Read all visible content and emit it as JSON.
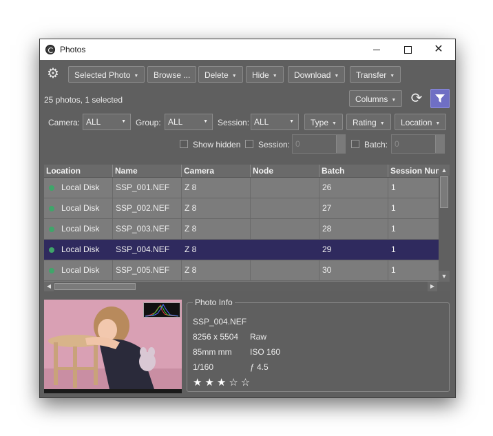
{
  "window": {
    "title": "Photos"
  },
  "toolbar": {
    "buttons": [
      {
        "label": "Selected Photo"
      },
      {
        "label": "Browse ..."
      },
      {
        "label": "Delete"
      },
      {
        "label": "Hide"
      },
      {
        "label": "Download"
      },
      {
        "label": "Transfer"
      }
    ],
    "status": "25 photos, 1 selected",
    "columns_label": "Columns"
  },
  "filters": {
    "camera_label": "Camera:",
    "camera_value": "ALL",
    "group_label": "Group:",
    "group_value": "ALL",
    "session_label": "Session:",
    "session_value": "ALL",
    "type_label": "Type",
    "rating_label": "Rating",
    "location_label": "Location",
    "show_hidden_label": "Show hidden",
    "session_spin_label": "Session:",
    "session_spin_value": "0",
    "batch_label": "Batch:",
    "batch_value": "0"
  },
  "table": {
    "columns": [
      "Location",
      "Name",
      "Camera",
      "Node",
      "Batch",
      "Session Num"
    ],
    "rows": [
      {
        "location": "Local Disk",
        "name": "SSP_001.NEF",
        "camera": "Z 8",
        "node": "",
        "batch": "26",
        "session": "1"
      },
      {
        "location": "Local Disk",
        "name": "SSP_002.NEF",
        "camera": "Z 8",
        "node": "",
        "batch": "27",
        "session": "1"
      },
      {
        "location": "Local Disk",
        "name": "SSP_003.NEF",
        "camera": "Z 8",
        "node": "",
        "batch": "28",
        "session": "1"
      },
      {
        "location": "Local Disk",
        "name": "SSP_004.NEF",
        "camera": "Z 8",
        "node": "",
        "batch": "29",
        "session": "1"
      },
      {
        "location": "Local Disk",
        "name": "SSP_005.NEF",
        "camera": "Z 8",
        "node": "",
        "batch": "30",
        "session": "1"
      }
    ],
    "selected_index": 3
  },
  "photo_info": {
    "legend": "Photo Info",
    "filename": "SSP_004.NEF",
    "dimensions": "8256 x 5504",
    "format": "Raw",
    "focal": "85mm mm",
    "iso": "ISO 160",
    "shutter": "1/160",
    "aperture": "ƒ 4.5",
    "stars": "★★★☆☆"
  },
  "colors": {
    "selected_row": "#2f2a5e",
    "filter_button": "#6f6fc4",
    "location_dot": "#3fa56a"
  }
}
